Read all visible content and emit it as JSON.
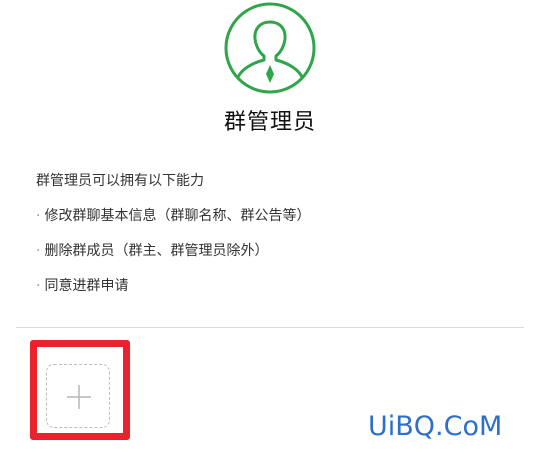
{
  "header": {
    "icon": "admin-avatar-icon",
    "title": "群管理员"
  },
  "permissions": {
    "intro": "群管理员可以拥有以下能力",
    "bullet": "·",
    "items": [
      "修改群聊基本信息（群聊名称、群公告等）",
      "删除群成员（群主、群管理员除外）",
      "同意进群申请"
    ]
  },
  "members": {
    "add_icon": "plus-icon"
  },
  "watermark": "UiBQ.CoM",
  "colors": {
    "accent": "#2fa54a",
    "highlight": "#e8232b",
    "watermark": "#2d6fc9"
  }
}
